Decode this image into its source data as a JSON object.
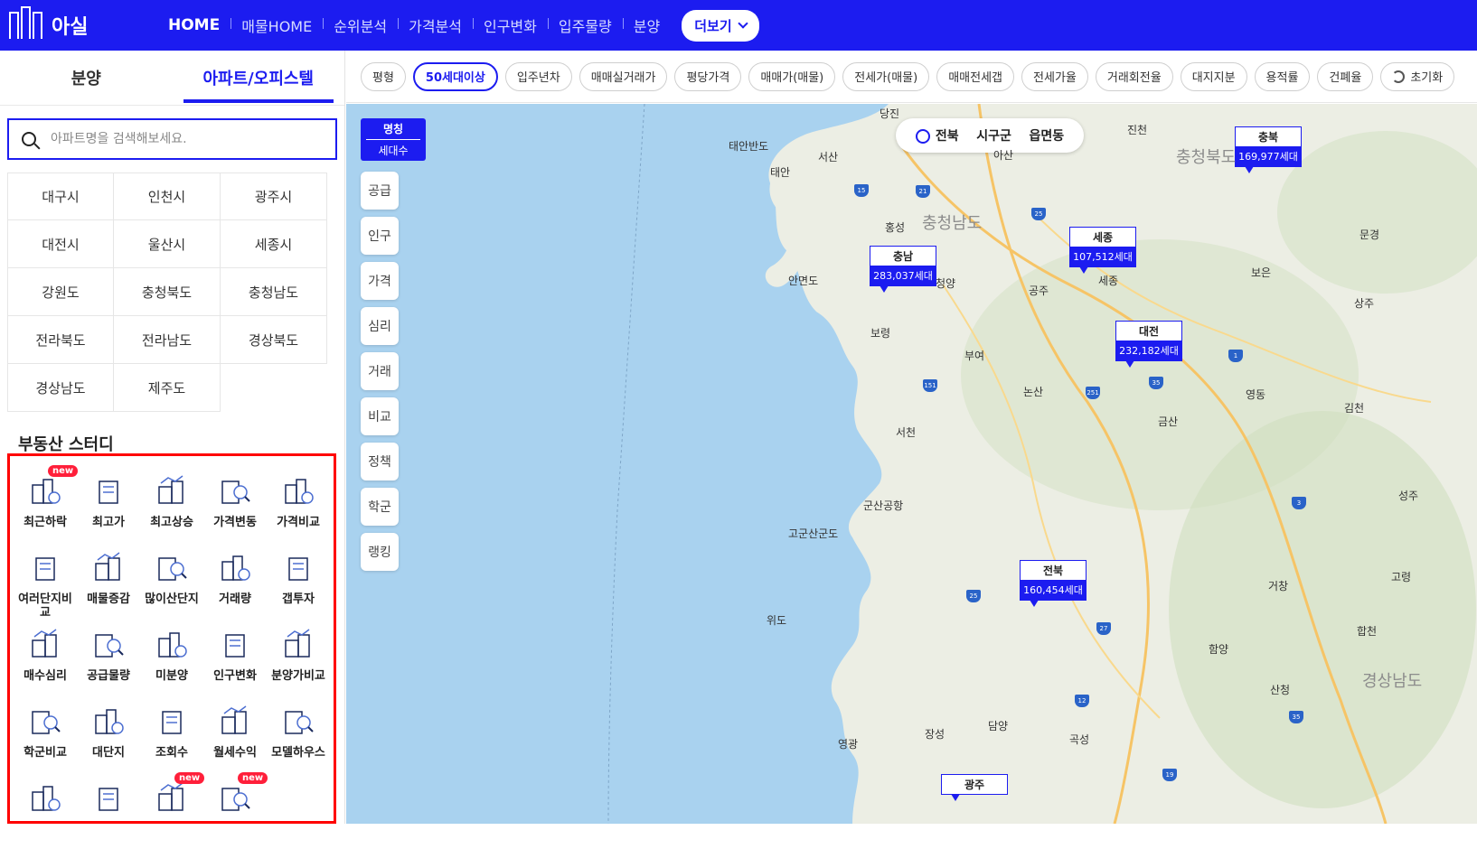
{
  "brand": {
    "name": "아실"
  },
  "nav": {
    "items": [
      "HOME",
      "매물HOME",
      "순위분석",
      "가격분석",
      "인구변화",
      "입주물량",
      "분양"
    ],
    "more_label": "더보기"
  },
  "sidebar": {
    "tabs": [
      "분양",
      "아파트/오피스텔"
    ],
    "active_tab": "아파트/오피스텔",
    "search": {
      "placeholder": "아파트명을 검색해보세요.",
      "value": ""
    },
    "regions": [
      "대구시",
      "인천시",
      "광주시",
      "대전시",
      "울산시",
      "세종시",
      "강원도",
      "충청북도",
      "충청남도",
      "전라북도",
      "전라남도",
      "경상북도",
      "경상남도",
      "제주도"
    ],
    "study_title": "부동산 스터디",
    "study_items": [
      {
        "label": "최근하락",
        "icon": "chart-building-icon",
        "new": true
      },
      {
        "label": "최고가",
        "icon": "building-coin-icon",
        "new": false
      },
      {
        "label": "최고상승",
        "icon": "building-rise-icon",
        "new": false
      },
      {
        "label": "가격변동",
        "icon": "magnify-building-icon",
        "new": false
      },
      {
        "label": "가격비교",
        "icon": "compare-glass-icon",
        "new": false
      },
      {
        "label": "여러단지비교",
        "icon": "line-chart-icon",
        "new": false
      },
      {
        "label": "매물증감",
        "icon": "listing-building-icon",
        "new": false
      },
      {
        "label": "많이산단지",
        "icon": "fire-building-icon",
        "new": false
      },
      {
        "label": "거래량",
        "icon": "map-trade-icon",
        "new": false
      },
      {
        "label": "갭투자",
        "icon": "person-chart-icon",
        "new": false
      },
      {
        "label": "매수심리",
        "icon": "heart-pulse-icon",
        "new": false
      },
      {
        "label": "공급물량",
        "icon": "crane-building-icon",
        "new": false
      },
      {
        "label": "미분양",
        "icon": "empty-building-icon",
        "new": false
      },
      {
        "label": "인구변화",
        "icon": "people-chart-icon",
        "new": false
      },
      {
        "label": "분양가비교",
        "icon": "building-vs-icon",
        "new": false
      },
      {
        "label": "학군비교",
        "icon": "school-icon",
        "new": false
      },
      {
        "label": "대단지",
        "icon": "large-complex-icon",
        "new": false
      },
      {
        "label": "조회수",
        "icon": "search-building-icon",
        "new": false
      },
      {
        "label": "월세수익",
        "icon": "money-bag-icon",
        "new": false
      },
      {
        "label": "모델하우스",
        "icon": "model-house-icon",
        "new": false
      },
      {
        "label": "",
        "icon": "hand-money-icon",
        "new": false
      },
      {
        "label": "",
        "icon": "chat-building-icon",
        "new": false
      },
      {
        "label": "",
        "icon": "shop-icon",
        "new": true
      },
      {
        "label": "",
        "icon": "market-icon",
        "new": true
      }
    ],
    "new_badge": "new"
  },
  "filters": {
    "chips": [
      "평형",
      "50세대이상",
      "입주년차",
      "매매실거래가",
      "평당가격",
      "매매가(매물)",
      "전세가(매물)",
      "매매전세갭",
      "전세가율",
      "거래회전율",
      "대지지분",
      "용적률",
      "건폐율"
    ],
    "active_chip": "50세대이상",
    "reset_label": "초기화"
  },
  "map": {
    "legend": {
      "line1": "명칭",
      "line2": "세대수"
    },
    "side_buttons": [
      "공급",
      "인구",
      "가격",
      "심리",
      "거래",
      "비교",
      "정책",
      "학군",
      "랭킹"
    ],
    "level_bar": {
      "current": "전북",
      "items": [
        "시구군",
        "읍면동"
      ]
    },
    "markers": [
      {
        "name": "충남",
        "value": "283,037세대"
      },
      {
        "name": "세종",
        "value": "107,512세대"
      },
      {
        "name": "대전",
        "value": "232,182세대"
      },
      {
        "name": "충북",
        "value": "169,977세대"
      },
      {
        "name": "전북",
        "value": "160,454세대"
      },
      {
        "name": "광주",
        "value": ""
      }
    ],
    "places": [
      "당진",
      "서산",
      "태안",
      "태안반도",
      "홍성",
      "충청남도",
      "청양",
      "안면도",
      "보령",
      "부여",
      "공주",
      "세종",
      "논산",
      "금산",
      "서천",
      "군산공항",
      "고군산군도",
      "위도",
      "영광",
      "장성",
      "담양",
      "곡성",
      "산청",
      "함양",
      "거창",
      "합천",
      "김천",
      "영동",
      "상주",
      "보은",
      "문경",
      "진천",
      "아산",
      "충청북도",
      "경상남도",
      "고령",
      "성주"
    ]
  }
}
